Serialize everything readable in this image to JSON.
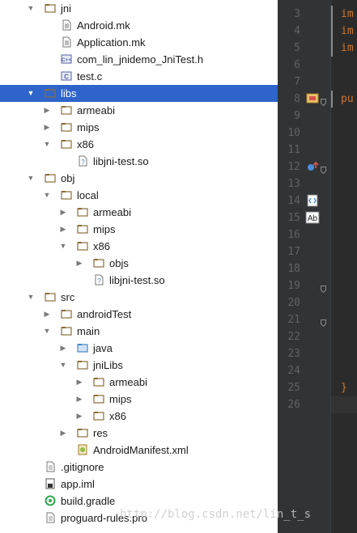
{
  "tree": [
    {
      "label": "jni",
      "type": "folder",
      "depth": 0,
      "arrow": "open"
    },
    {
      "label": "Android.mk",
      "type": "mk",
      "depth": 1,
      "arrow": "none"
    },
    {
      "label": "Application.mk",
      "type": "mk",
      "depth": 1,
      "arrow": "none"
    },
    {
      "label": "com_lin_jnidemo_JniTest.h",
      "type": "header",
      "depth": 1,
      "arrow": "none"
    },
    {
      "label": "test.c",
      "type": "csrc",
      "depth": 1,
      "arrow": "none"
    },
    {
      "label": "libs",
      "type": "folder",
      "depth": 0,
      "arrow": "open",
      "selected": true
    },
    {
      "label": "armeabi",
      "type": "folder",
      "depth": 1,
      "arrow": "closed"
    },
    {
      "label": "mips",
      "type": "folder",
      "depth": 1,
      "arrow": "closed"
    },
    {
      "label": "x86",
      "type": "folder",
      "depth": 1,
      "arrow": "open"
    },
    {
      "label": "libjni-test.so",
      "type": "unknown",
      "depth": 2,
      "arrow": "none"
    },
    {
      "label": "obj",
      "type": "folder",
      "depth": 0,
      "arrow": "open"
    },
    {
      "label": "local",
      "type": "folder",
      "depth": 1,
      "arrow": "open"
    },
    {
      "label": "armeabi",
      "type": "folder",
      "depth": 2,
      "arrow": "closed"
    },
    {
      "label": "mips",
      "type": "folder",
      "depth": 2,
      "arrow": "closed"
    },
    {
      "label": "x86",
      "type": "folder",
      "depth": 2,
      "arrow": "open"
    },
    {
      "label": "objs",
      "type": "folder",
      "depth": 3,
      "arrow": "closed"
    },
    {
      "label": "libjni-test.so",
      "type": "unknown",
      "depth": 3,
      "arrow": "none"
    },
    {
      "label": "src",
      "type": "folder",
      "depth": 0,
      "arrow": "open"
    },
    {
      "label": "androidTest",
      "type": "folder",
      "depth": 1,
      "arrow": "closed"
    },
    {
      "label": "main",
      "type": "folder",
      "depth": 1,
      "arrow": "open"
    },
    {
      "label": "java",
      "type": "srcfolder",
      "depth": 2,
      "arrow": "closed"
    },
    {
      "label": "jniLibs",
      "type": "folder",
      "depth": 2,
      "arrow": "open"
    },
    {
      "label": "armeabi",
      "type": "folder",
      "depth": 3,
      "arrow": "closed"
    },
    {
      "label": "mips",
      "type": "folder",
      "depth": 3,
      "arrow": "closed"
    },
    {
      "label": "x86",
      "type": "folder",
      "depth": 3,
      "arrow": "closed"
    },
    {
      "label": "res",
      "type": "folder",
      "depth": 2,
      "arrow": "closed"
    },
    {
      "label": "AndroidManifest.xml",
      "type": "manifest",
      "depth": 2,
      "arrow": "none"
    },
    {
      "label": ".gitignore",
      "type": "text",
      "depth": 0,
      "arrow": "none"
    },
    {
      "label": "app.iml",
      "type": "iml",
      "depth": 0,
      "arrow": "none"
    },
    {
      "label": "build.gradle",
      "type": "gradle",
      "depth": 0,
      "arrow": "none"
    },
    {
      "label": "proguard-rules.pro",
      "type": "text",
      "depth": 0,
      "arrow": "none"
    }
  ],
  "editor": {
    "line_numbers": [
      "3",
      "4",
      "5",
      "6",
      "7",
      "8",
      "9",
      "10",
      "11",
      "12",
      "13",
      "14",
      "15",
      "16",
      "17",
      "18",
      "19",
      "20",
      "21",
      "22",
      "23",
      "24",
      "25",
      "26"
    ],
    "code": [
      {
        "line": "3",
        "text": "im"
      },
      {
        "line": "4",
        "text": "im"
      },
      {
        "line": "5",
        "text": "im"
      },
      {
        "line": "8",
        "text": "pu"
      },
      {
        "line": "25",
        "text": "}"
      }
    ]
  },
  "watermark": "http://blog.csdn.net/lin_t_s"
}
